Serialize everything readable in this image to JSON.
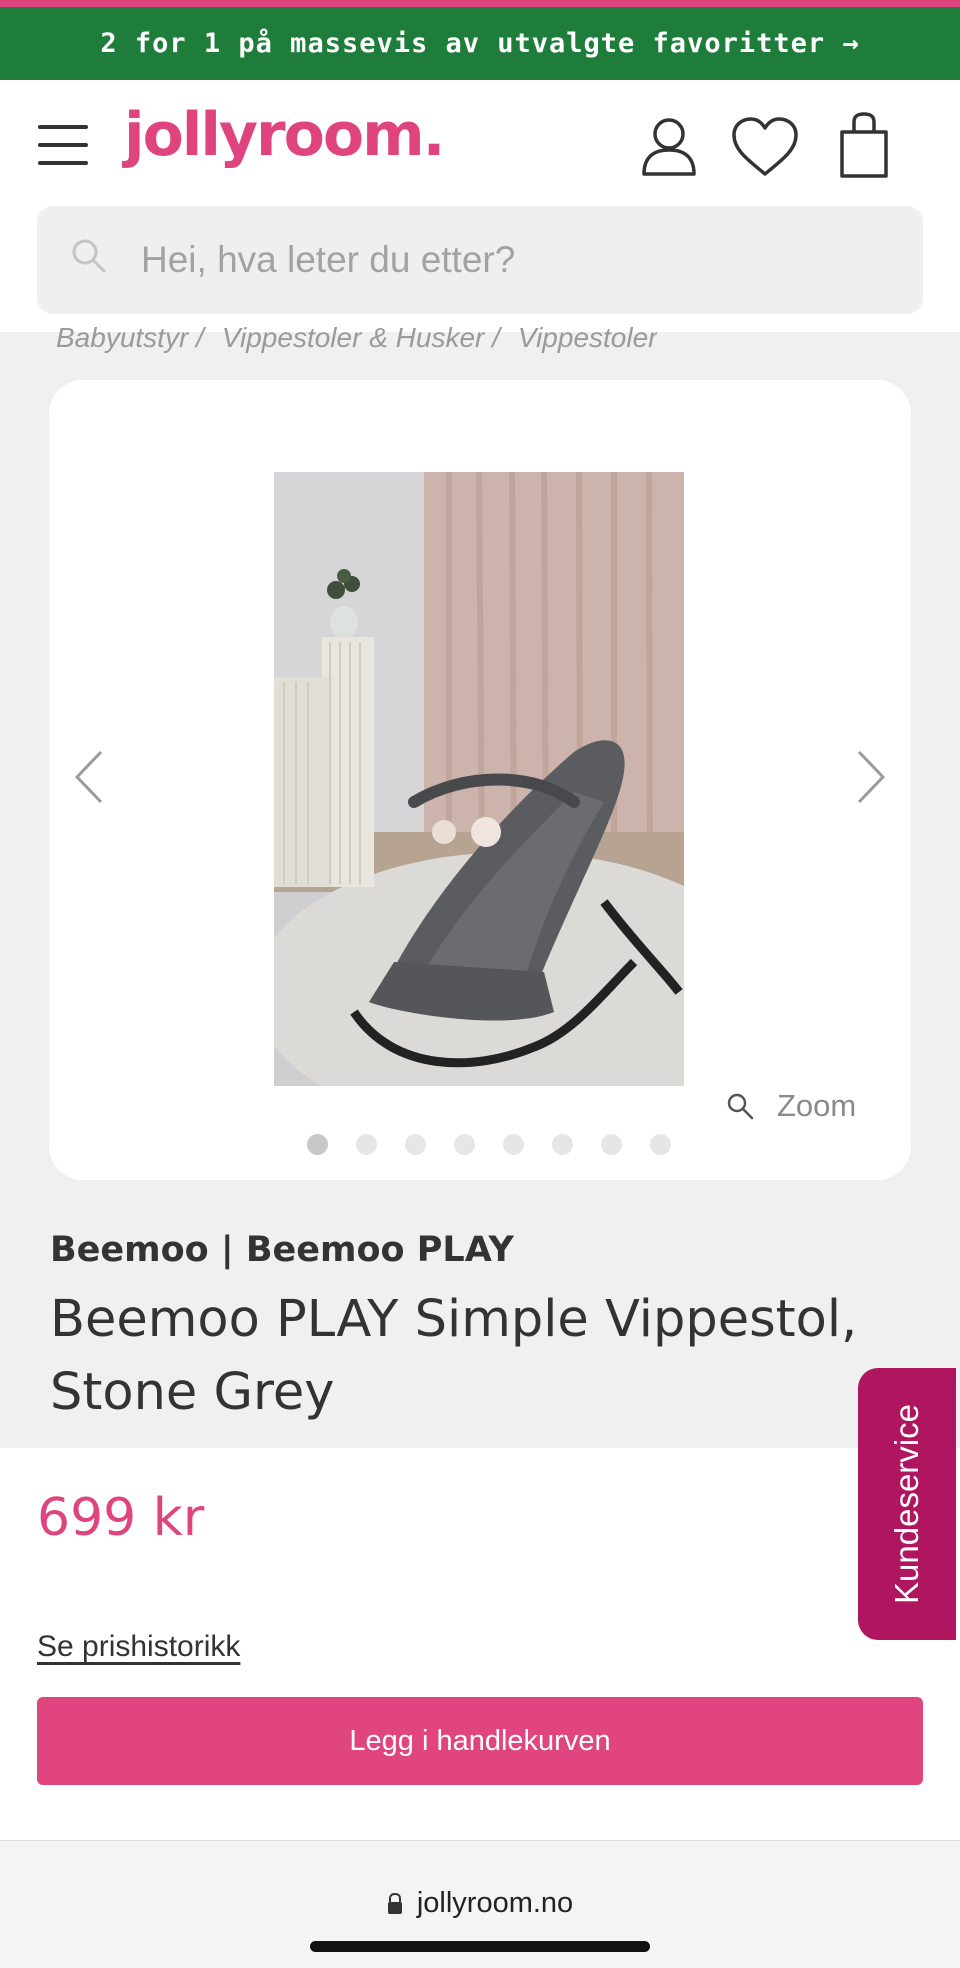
{
  "promo": {
    "text": "2 for 1 på massevis av utvalgte favoritter →"
  },
  "header": {
    "logo_text": "jollyroom.",
    "brand_color": "#e0447f",
    "icons": [
      "hamburger-menu-icon",
      "user-icon",
      "heart-icon",
      "shopping-bag-icon"
    ]
  },
  "search": {
    "placeholder": "Hei, hva leter du etter?"
  },
  "breadcrumb": {
    "items": [
      "Babyutstyr /",
      "Vippestoler & Husker /",
      "Vippestoler"
    ]
  },
  "gallery": {
    "zoom_label": "Zoom",
    "total_images": 8,
    "active_index": 0
  },
  "product": {
    "brand_line": "Beemoo | Beemoo PLAY",
    "title": "Beemoo PLAY Simple Vippestol, Stone Grey",
    "price": "699 kr",
    "price_history_link": "Se prishistorikk",
    "add_to_cart": "Legg i handlekurven"
  },
  "customer_service": {
    "label": "Kundeservice"
  },
  "browser": {
    "url": "jollyroom.no"
  },
  "colors": {
    "promo_green": "#1f7d3c",
    "pink": "#e0447f",
    "service": "#b0155f"
  }
}
